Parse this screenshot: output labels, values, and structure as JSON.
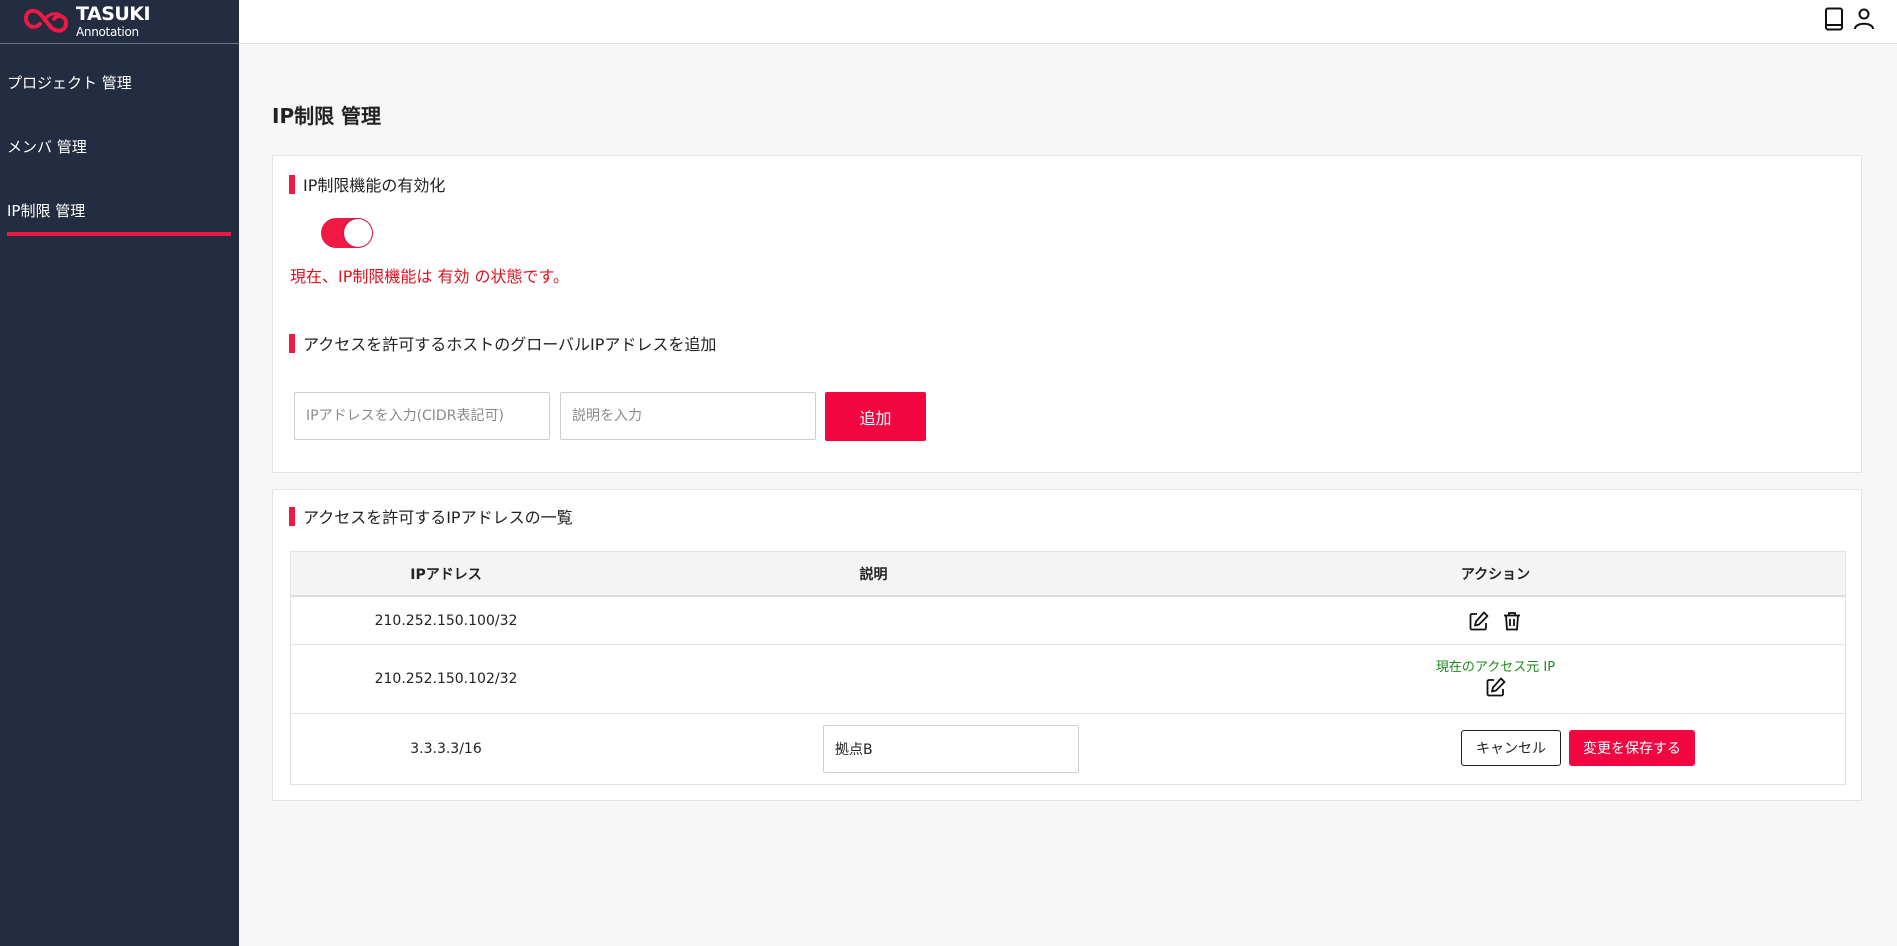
{
  "brand": {
    "name": "TASUKI",
    "sub": "Annotation",
    "accent": "#ef1a44",
    "sidebar_bg": "#232c40"
  },
  "sidebar": {
    "items": [
      {
        "label": "プロジェクト 管理"
      },
      {
        "label": "メンバ 管理"
      },
      {
        "label": "IP制限 管理",
        "active": true
      }
    ]
  },
  "topbar": {
    "icons": [
      "book-icon",
      "user-icon"
    ]
  },
  "page": {
    "title": "IP制限 管理"
  },
  "enable_section": {
    "heading": "IP制限機能の有効化",
    "toggle_on": true,
    "status_text": "現在、IP制限機能は 有効 の状態です。"
  },
  "add_section": {
    "heading": "アクセスを許可するホストのグローバルIPアドレスを追加",
    "ip_placeholder": "IPアドレスを入力(CIDR表記可)",
    "desc_placeholder": "説明を入力",
    "add_label": "追加"
  },
  "list_section": {
    "heading": "アクセスを許可するIPアドレスの一覧",
    "columns": [
      "IPアドレス",
      "説明",
      "アクション"
    ],
    "rows": [
      {
        "ip": "210.252.150.100/32",
        "description": "",
        "actions": [
          "edit-icon",
          "trash-icon"
        ]
      },
      {
        "ip": "210.252.150.102/32",
        "description": "",
        "note": "現在のアクセス元 IP",
        "actions": [
          "edit-icon"
        ]
      },
      {
        "ip": "3.3.3.3/16",
        "description_edit_value": "拠点B",
        "cancel_label": "キャンセル",
        "save_label": "変更を保存する"
      }
    ]
  }
}
